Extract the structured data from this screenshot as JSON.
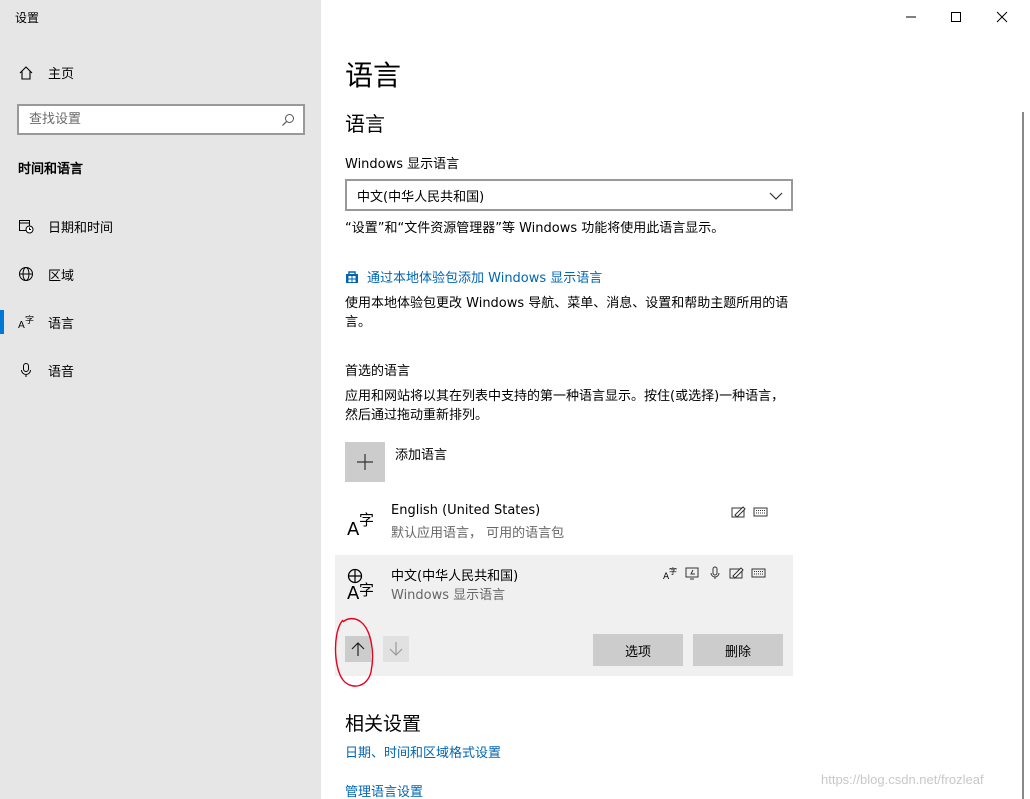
{
  "app": {
    "title": "设置"
  },
  "sidebar": {
    "home_label": "主页",
    "search_placeholder": "查找设置",
    "section_heading": "时间和语言",
    "items": [
      {
        "label": "日期和时间",
        "icon": "calendar-clock-icon"
      },
      {
        "label": "区域",
        "icon": "globe-icon"
      },
      {
        "label": "语言",
        "icon": "language-icon",
        "active": true
      },
      {
        "label": "语音",
        "icon": "microphone-icon"
      }
    ]
  },
  "window_controls": {
    "minimize": "minimize",
    "maximize": "maximize",
    "close": "close"
  },
  "main": {
    "page_title": "语言",
    "section_title": "语言",
    "display_language_label": "Windows 显示语言",
    "display_language_value": "中文(中华人民共和国)",
    "display_language_note": "“设置”和“文件资源管理器”等 Windows 功能将使用此语言显示。",
    "add_display_lang_link": "通过本地体验包添加 Windows 显示语言",
    "add_display_lang_desc": "使用本地体验包更改 Windows 导航、菜单、消息、设置和帮助主题所用的语言。",
    "preferred_heading": "首选的语言",
    "preferred_desc": "应用和网站将以其在列表中支持的第一种语言显示。按住(或选择)一种语言，然后通过拖动重新排列。",
    "add_language_label": "添加语言",
    "languages": [
      {
        "name": "English (United States)",
        "sub": "默认应用语言， 可用的语言包"
      },
      {
        "name": "中文(中华人民共和国)",
        "sub": "Windows 显示语言"
      }
    ],
    "options_button": "选项",
    "remove_button": "删除",
    "related_heading": "相关设置",
    "related_links": [
      "日期、时间和区域格式设置",
      "管理语言设置"
    ]
  },
  "watermark": "https://blog.csdn.net/frozleaf",
  "colors": {
    "accent": "#0078d7",
    "link": "#0066b4",
    "annotation": "#e8001c"
  }
}
